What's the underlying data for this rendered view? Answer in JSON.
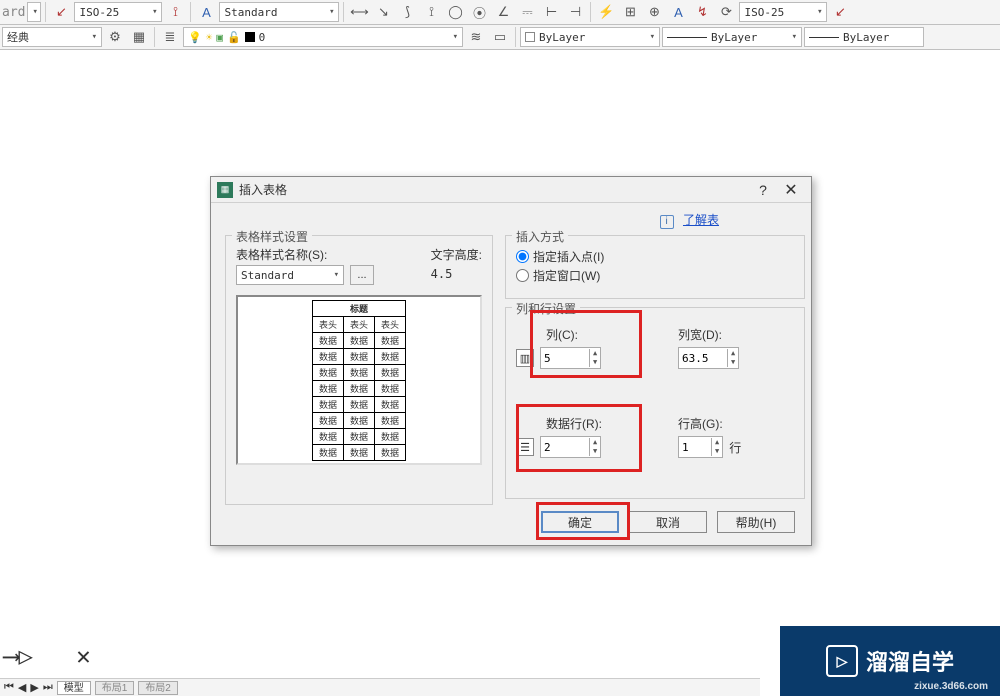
{
  "toolbar": {
    "style1": "ISO-25",
    "style2": "Standard",
    "style3": "ISO-25",
    "ws_label": "经典",
    "layer_color": "0",
    "bylayer1": "ByLayer",
    "bylayer2": "ByLayer",
    "bylayer3": "ByLayer"
  },
  "dialog": {
    "title": "插入表格",
    "learn_more": "了解表",
    "style_group_label": "表格样式设置",
    "style_name_label": "表格样式名称(S):",
    "style_name_value": "Standard",
    "text_height_label": "文字高度:",
    "text_height_value": "4.5",
    "preview_header": "标题",
    "preview_rowhead": [
      "表头",
      "表头",
      "表头"
    ],
    "preview_cell": "数据",
    "insert_group_label": "插入方式",
    "radio_point": "指定插入点(I)",
    "radio_window": "指定窗口(W)",
    "cr_group_label": "列和行设置",
    "cols": {
      "label": "列(C):",
      "value": "5"
    },
    "colw": {
      "label": "列宽(D):",
      "value": "63.5"
    },
    "rows": {
      "label": "数据行(R):",
      "value": "2"
    },
    "rowh": {
      "label": "行高(G):",
      "value": "1",
      "suffix": "行"
    },
    "ok": "确定",
    "cancel": "取消",
    "help": "帮助(H)"
  },
  "status": {
    "tab_model": "模型",
    "tab_layout1": "布局1",
    "tab_layout2": "布局2"
  },
  "watermark": {
    "text": "溜溜自学",
    "url": "zixue.3d66.com"
  },
  "cmdprefix": "ard"
}
